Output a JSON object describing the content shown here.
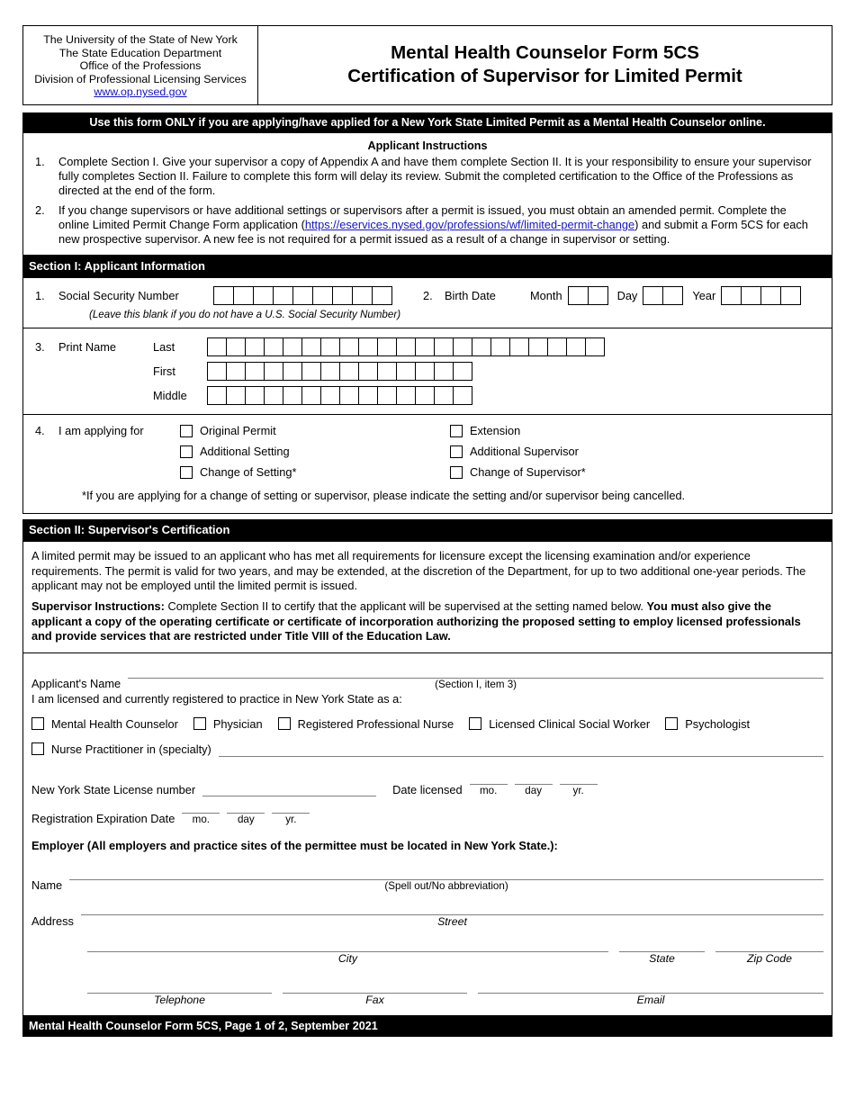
{
  "header": {
    "agency_lines": [
      "The University of the State of New York",
      "The State Education Department",
      "Office of the Professions",
      "Division of Professional Licensing Services"
    ],
    "url": "www.op.nysed.gov",
    "title_line1": "Mental Health Counselor Form 5CS",
    "title_line2": "Certification of Supervisor for Limited Permit"
  },
  "notice_bar": "Use this form ONLY if you are applying/have applied for a New York State Limited Permit as a Mental Health Counselor online.",
  "instructions": {
    "title": "Applicant Instructions",
    "items": [
      {
        "num": "1.",
        "text": "Complete Section I. Give your supervisor a copy of Appendix A and have them complete Section II. It is your responsibility to ensure your supervisor fully completes Section II. Failure to complete this form will delay its review. Submit the completed certification to the Office of the Professions as directed at the end of the form."
      },
      {
        "num": "2.",
        "text_before": "If you change supervisors or have additional settings or supervisors after a permit is issued, you must obtain an amended permit. Complete the online Limited Permit Change Form application (",
        "link": "https://eservices.nysed.gov/professions/wf/limited-permit-change",
        "text_after": ") and submit a Form 5CS for each new prospective supervisor. A new fee is not required for a permit issued as a result of a change in supervisor or setting."
      }
    ]
  },
  "section1": {
    "bar": "Section I: Applicant Information",
    "ssn": {
      "num": "1.",
      "label": "Social Security Number",
      "boxes": 9,
      "note": "(Leave this blank if you do not have a U.S. Social Security Number)"
    },
    "birthdate": {
      "num": "2.",
      "label": "Birth Date",
      "month_label": "Month",
      "month_boxes": 2,
      "day_label": "Day",
      "day_boxes": 2,
      "year_label": "Year",
      "year_boxes": 4
    },
    "print_name": {
      "num": "3.",
      "label": "Print Name",
      "rows": [
        {
          "label": "Last",
          "boxes": 21
        },
        {
          "label": "First",
          "boxes": 14
        },
        {
          "label": "Middle",
          "boxes": 14
        }
      ]
    },
    "applying_for": {
      "num": "4.",
      "label": "I am applying for",
      "options_left": [
        "Original Permit",
        "Additional Setting",
        "Change of Setting*"
      ],
      "options_right": [
        "Extension",
        "Additional Supervisor",
        "Change of Supervisor*"
      ],
      "footnote": "*If you are applying for a change of setting or supervisor, please indicate the setting and/or supervisor being cancelled."
    }
  },
  "section2": {
    "bar": "Section II: Supervisor's Certification",
    "paragraph1": "A limited permit may be issued to an applicant who has met all requirements for licensure except the licensing examination and/or experience requirements. The permit is valid for two years, and may be extended, at the discretion of the Department, for up to two additional one-year periods. The applicant may not be employed until the limited permit is issued.",
    "supervisor_instructions": {
      "heading": "Supervisor Instructions:",
      "normal1": " Complete Section II to certify that the applicant will be supervised at the setting named below. ",
      "bold1": "You must also give the applicant a copy of the operating certificate or certificate of incorporation authorizing the proposed setting to employ licensed professionals and provide services that are restricted under Title VIII of the Education Law."
    },
    "applicant_name_label": "Applicant's Name",
    "applicant_name_caption": "(Section I, item 3)",
    "licensed_intro": "I am licensed and currently registered to practice in New York State as a:",
    "profession_options": [
      "Mental Health Counselor",
      "Physician",
      "Registered Professional Nurse",
      "Licensed Clinical Social Worker",
      "Psychologist"
    ],
    "nurse_practitioner_label": "Nurse Practitioner in (specialty)",
    "license_number_label": "New York State License number",
    "date_licensed_label": "Date licensed",
    "date_parts": [
      "mo.",
      "day",
      "yr."
    ],
    "registration_expiration_label": "Registration Expiration Date",
    "employer_heading": "Employer (All employers and practice sites of the permittee must be located in New York State.):",
    "employer_name_label": "Name",
    "employer_name_caption": "(Spell out/No abbreviation)",
    "address_label": "Address",
    "street_caption": "Street",
    "city_caption": "City",
    "state_caption": "State",
    "zip_caption": "Zip Code",
    "telephone_caption": "Telephone",
    "fax_caption": "Fax",
    "email_caption": "Email"
  },
  "footer_bar": "Mental Health Counselor Form 5CS, Page 1 of 2, September 2021"
}
